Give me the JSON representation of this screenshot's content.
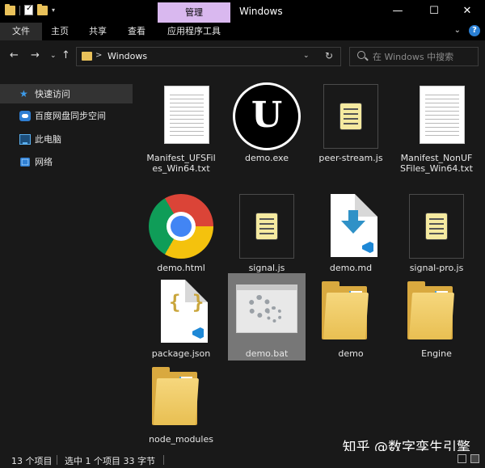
{
  "window": {
    "title": "Windows",
    "context_tab": "管理",
    "minimize": "—",
    "maximize": "☐",
    "close": "✕"
  },
  "ribbon": {
    "tabs": [
      "文件",
      "主页",
      "共享",
      "查看",
      "应用程序工具"
    ],
    "collapse": "⌄",
    "help": "?"
  },
  "addressbar": {
    "back": "←",
    "forward": "→",
    "up": "↑",
    "separator": ">",
    "path": "Windows",
    "dropdown": "⌄",
    "refresh": "↻",
    "search_placeholder": "在 Windows 中搜索"
  },
  "navpane": {
    "items": [
      {
        "label": "快速访问",
        "icon": "star-icon"
      },
      {
        "label": "百度网盘同步空间",
        "icon": "cloud-icon"
      },
      {
        "label": "此电脑",
        "icon": "computer-icon"
      },
      {
        "label": "网络",
        "icon": "network-icon"
      }
    ]
  },
  "files": [
    {
      "name": "Manifest_UFSFiles_Win64.txt",
      "icon": "text-document-icon"
    },
    {
      "name": "demo.exe",
      "icon": "unreal-engine-icon"
    },
    {
      "name": "peer-stream.js",
      "icon": "javascript-file-icon"
    },
    {
      "name": "Manifest_NonUFSFiles_Win64.txt",
      "icon": "text-document-icon"
    },
    {
      "name": "demo.html",
      "icon": "chrome-icon"
    },
    {
      "name": "signal.js",
      "icon": "javascript-file-icon"
    },
    {
      "name": "demo.md",
      "icon": "markdown-file-icon"
    },
    {
      "name": "signal-pro.js",
      "icon": "javascript-file-icon"
    },
    {
      "name": "package.json",
      "icon": "json-file-icon"
    },
    {
      "name": "demo.bat",
      "icon": "batch-file-icon",
      "selected": true
    },
    {
      "name": "demo",
      "icon": "folder-icon"
    },
    {
      "name": "Engine",
      "icon": "folder-icon"
    },
    {
      "name": "node_modules",
      "icon": "folder-icon"
    }
  ],
  "status": {
    "item_count": "13 个项目",
    "selection": "选中 1 个项目  33 字节"
  },
  "watermark": "知乎 @数字孪生引擎",
  "json_braces": "{ }",
  "ue_letter": "U"
}
